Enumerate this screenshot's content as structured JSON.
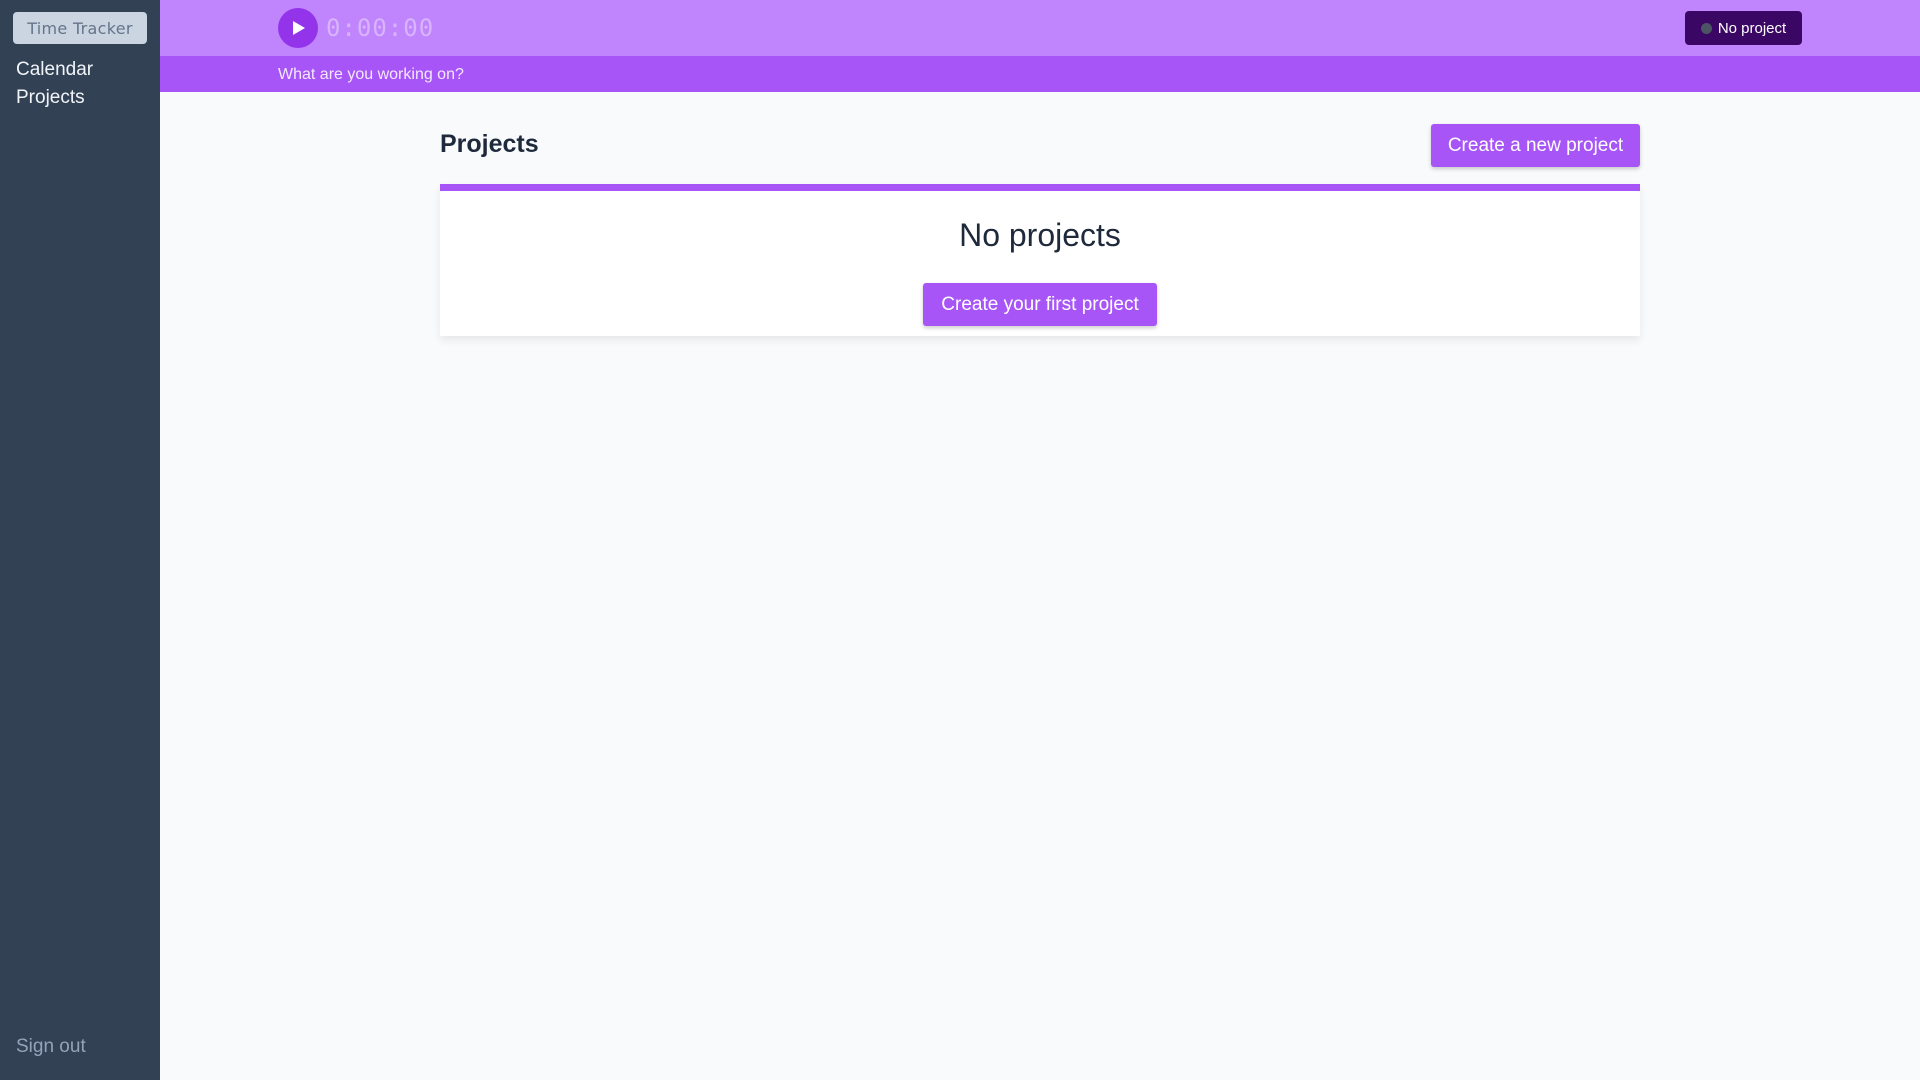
{
  "sidebar": {
    "brand": "Time Tracker",
    "nav": [
      {
        "label": "Calendar"
      },
      {
        "label": "Projects"
      }
    ],
    "sign_out": "Sign out"
  },
  "header": {
    "timer": "0:00:00",
    "project_button": "No project",
    "description_placeholder": "What are you working on?"
  },
  "main": {
    "title": "Projects",
    "create_new_label": "Create a new project",
    "empty_state": {
      "title": "No projects",
      "create_first_label": "Create your first project"
    }
  },
  "colors": {
    "sidebar_bg": "#334155",
    "header_bg": "#c084fc",
    "subheader_bg": "#a855f7",
    "accent": "#a855f7",
    "play_button": "#9333ea",
    "project_button_bg": "#3b0764"
  },
  "icons": {
    "play": "play-icon",
    "project_dot": "status-dot-icon"
  }
}
